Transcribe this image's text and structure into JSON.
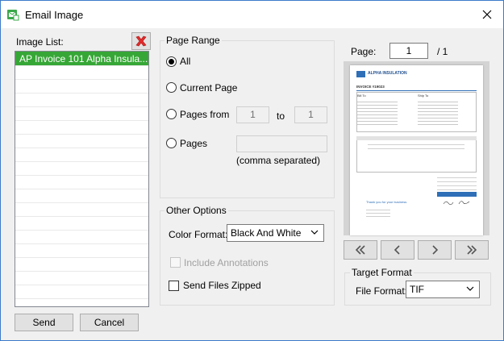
{
  "window": {
    "title": "Email Image",
    "accent_color": "#3c7bc9"
  },
  "image_list": {
    "label": "Image List:",
    "items": [
      "AP Invoice 101 Alpha Insula..."
    ],
    "selected_index": 0,
    "selected_color": "#36a736"
  },
  "page_range": {
    "title": "Page Range",
    "options": {
      "all": "All",
      "current": "Current Page",
      "from": "Pages from",
      "pages": "Pages"
    },
    "selected": "all",
    "from_value": "1",
    "to_label": "to",
    "to_value": "1",
    "pages_value": "",
    "comma_note": "(comma separated)"
  },
  "other_options": {
    "title": "Other Options",
    "color_format_label": "Color Format:",
    "color_format_value": "Black And White",
    "include_annotations_label": "Include Annotations",
    "include_annotations_enabled": false,
    "send_zipped_label": "Send Files Zipped",
    "send_zipped_checked": false
  },
  "preview": {
    "page_label": "Page:",
    "page_value": "1",
    "page_total": "/ 1",
    "document": {
      "company": "ALPHA INSULATION",
      "invoice_title": "INVOICE #19023",
      "bill_to": "Bill To",
      "ship_to": "Ship To",
      "thanks": "Thank you for your business"
    }
  },
  "target_format": {
    "title": "Target Format",
    "file_format_label": "File Format:",
    "file_format_value": "TIF"
  },
  "buttons": {
    "send": "Send",
    "cancel": "Cancel"
  },
  "icons": {
    "title": "email-image-icon",
    "delete": "red-x-delete-icon",
    "first": "double-chevron-left-icon",
    "prev": "chevron-left-icon",
    "next": "chevron-right-icon",
    "last": "double-chevron-right-icon"
  }
}
